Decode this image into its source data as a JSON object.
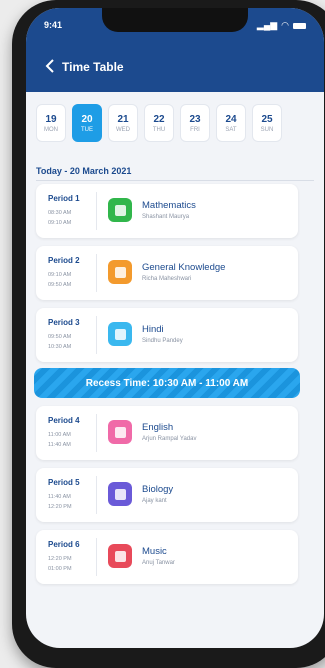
{
  "status": {
    "time": "9:41"
  },
  "header": {
    "title": "Time Table"
  },
  "dates": [
    {
      "num": "19",
      "day": "MON",
      "selected": false
    },
    {
      "num": "20",
      "day": "TUE",
      "selected": true
    },
    {
      "num": "21",
      "day": "WED",
      "selected": false
    },
    {
      "num": "22",
      "day": "THU",
      "selected": false
    },
    {
      "num": "23",
      "day": "FRI",
      "selected": false
    },
    {
      "num": "24",
      "day": "SAT",
      "selected": false
    },
    {
      "num": "25",
      "day": "SUN",
      "selected": false
    }
  ],
  "today_label": "Today - 20 March 2021",
  "periods": [
    {
      "period": "Period 1",
      "start": "08:30 AM",
      "end": "09:10 AM",
      "subject": "Mathematics",
      "teacher": "Shashant Maurya",
      "color": "#31b64b",
      "icon": "math-book-icon"
    },
    {
      "period": "Period 2",
      "start": "09:10 AM",
      "end": "09:50 AM",
      "subject": "General Knowledge",
      "teacher": "Richa Maheshwari",
      "color": "#f39a2d",
      "icon": "gk-book-icon"
    },
    {
      "period": "Period 3",
      "start": "09:50 AM",
      "end": "10:30 AM",
      "subject": "Hindi",
      "teacher": "Sindhu Pandey",
      "color": "#3ab8ef",
      "icon": "hindi-book-icon"
    },
    {
      "period": "Period 4",
      "start": "11:00 AM",
      "end": "11:40 AM",
      "subject": "English",
      "teacher": "Arjun Rampal Yadav",
      "color": "#f06aa8",
      "icon": "english-book-icon"
    },
    {
      "period": "Period 5",
      "start": "11:40 AM",
      "end": "12:20 PM",
      "subject": "Biology",
      "teacher": "Ajay kant",
      "color": "#6a5ad8",
      "icon": "biology-book-icon"
    },
    {
      "period": "Period 6",
      "start": "12:20 PM",
      "end": "01:00 PM",
      "subject": "Music",
      "teacher": "Anuj Tanwar",
      "color": "#e84a5a",
      "icon": "music-book-icon"
    }
  ],
  "recess": "Recess Time: 10:30 AM - 11:00 AM"
}
